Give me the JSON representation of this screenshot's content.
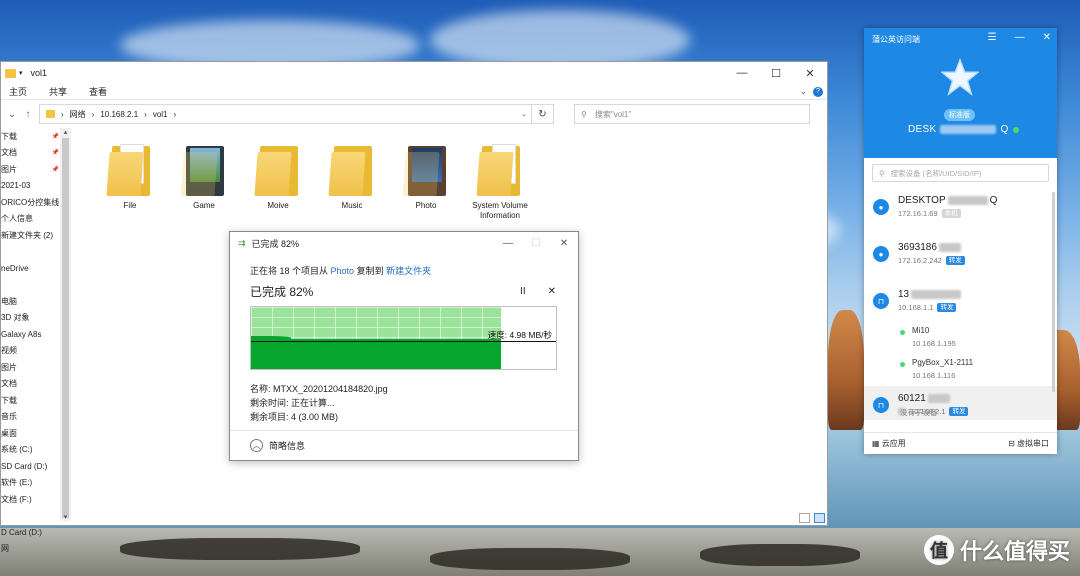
{
  "explorer": {
    "title": "vol1",
    "win_controls": [
      "—",
      "☐",
      "✕"
    ],
    "ribbon": [
      "主页",
      "共享",
      "查看"
    ],
    "breadcrumb": [
      "网络",
      "10.168.2.1",
      "vol1"
    ],
    "search_placeholder": "搜索\"vol1\"",
    "sidebar": [
      {
        "label": "下载",
        "pinned": true
      },
      {
        "label": "文档",
        "pinned": true
      },
      {
        "label": "图片",
        "pinned": true
      },
      {
        "label": "2021-03",
        "pinned": false
      },
      {
        "label": "ORICO分控集线",
        "pinned": false
      },
      {
        "label": "个人信息",
        "pinned": false
      },
      {
        "label": "新建文件夹 (2)",
        "pinned": false
      },
      {
        "label": "",
        "pinned": false
      },
      {
        "label": "neDrive",
        "pinned": false
      },
      {
        "label": "",
        "pinned": false
      },
      {
        "label": "电脑",
        "pinned": false
      },
      {
        "label": "3D 对象",
        "pinned": false
      },
      {
        "label": "Galaxy A8s",
        "pinned": false
      },
      {
        "label": "视频",
        "pinned": false
      },
      {
        "label": "图片",
        "pinned": false
      },
      {
        "label": "文档",
        "pinned": false
      },
      {
        "label": "下载",
        "pinned": false
      },
      {
        "label": "音乐",
        "pinned": false
      },
      {
        "label": "桌面",
        "pinned": false
      },
      {
        "label": "系统 (C:)",
        "pinned": false
      },
      {
        "label": "SD Card (D:)",
        "pinned": false
      },
      {
        "label": "软件 (E:)",
        "pinned": false
      },
      {
        "label": "文档 (F:)",
        "pinned": false
      },
      {
        "label": "",
        "pinned": false
      },
      {
        "label": "D Card (D:)",
        "pinned": false
      },
      {
        "label": "网",
        "pinned": false
      }
    ],
    "files": [
      {
        "name": "File",
        "kind": "pdf"
      },
      {
        "name": "Game",
        "kind": "photo"
      },
      {
        "name": "Moive",
        "kind": "plain"
      },
      {
        "name": "Music",
        "kind": "plain"
      },
      {
        "name": "Photo",
        "kind": "dark"
      },
      {
        "name": "System Volume Information",
        "kind": "doc"
      }
    ]
  },
  "dialog": {
    "title": "已完成 82%",
    "line_prefix": "正在将 18 个项目从",
    "source": "Photo",
    "line_mid": "复制到",
    "dest": "新建文件夹",
    "big": "已完成 82%",
    "pause_label": "II",
    "stop_label": "✕",
    "progress": 0.82,
    "speed": "速度: 4.98 MB/秒",
    "name": "名称: MTXX_20201204184820.jpg",
    "remaining_time": "剩余时间: 正在计算...",
    "remaining_items": "剩余项目: 4 (3.00 MB)",
    "more_info": "简略信息",
    "controls": [
      "—",
      "☐",
      "✕"
    ]
  },
  "panel": {
    "title": "蒲公英访问端",
    "controls": [
      "☰",
      "—",
      "✕"
    ],
    "edition": "标准版",
    "device": "DESK",
    "device_tail": "Q",
    "search_placeholder": "搜索设备 (名称/UID/SID/IP)",
    "rows": [
      {
        "name": "DESKTOP",
        "name_tail": "Q",
        "ip": "172.16.1.69",
        "tag": "本机",
        "tag_style": "gray",
        "icon": "person"
      },
      {
        "name": "3693186",
        "name_tail": "",
        "ip": "172.16.2.242",
        "tag": "转发",
        "tag_style": "blue",
        "icon": "person"
      },
      {
        "name": "13",
        "name_tail": "",
        "ip": "10.168.1.1",
        "tag": "转发",
        "tag_style": "blue",
        "icon": "router"
      }
    ],
    "subdevices": [
      {
        "name": "Mi10",
        "ip": "10.168.1.195"
      },
      {
        "name": "PgyBox_X1-2111",
        "ip": "10.168.1.116"
      }
    ],
    "selected_row": {
      "name": "60121",
      "ip": "10.168.2.1",
      "tag": "转发",
      "icon": "router"
    },
    "no_child": "没有子设备",
    "footer_left": "云应用",
    "footer_right": "虚拟串口"
  },
  "watermark": {
    "text": "什么值得买",
    "logo": "值"
  }
}
